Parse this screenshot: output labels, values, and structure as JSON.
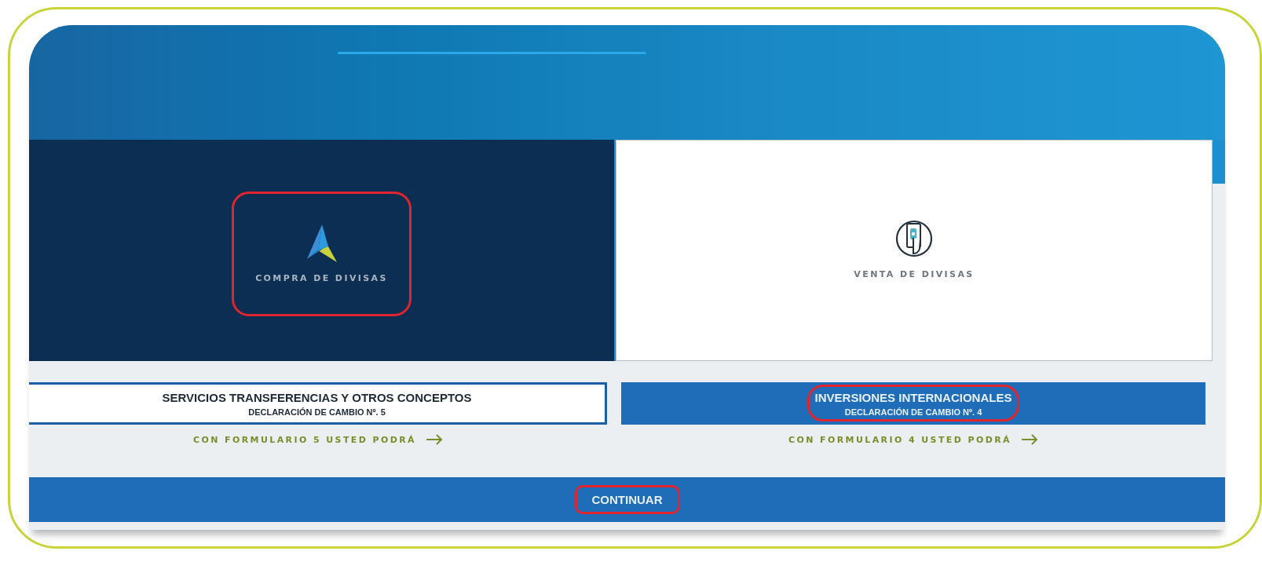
{
  "tiles": [
    {
      "kind": "arrow",
      "label": "COMPRA DE DIVISAS",
      "selected": true,
      "highlighted": true
    },
    {
      "kind": "phone",
      "label": "VENTA DE DIVISAS",
      "selected": false,
      "highlighted": false
    }
  ],
  "forms": [
    {
      "title": "SERVICIOS TRANSFERENCIAS Y OTROS CONCEPTOS",
      "subtitle": "DECLARACIÓN DE CAMBIO Nº. 5",
      "selected": false,
      "highlighted": false,
      "link": "CON FORMULARIO 5 USTED PODRÁ"
    },
    {
      "title": "INVERSIONES INTERNACIONALES",
      "subtitle": "DECLARACIÓN DE CAMBIO Nº. 4",
      "selected": true,
      "highlighted": true,
      "link": "CON FORMULARIO 4 USTED PODRÁ"
    }
  ],
  "continue_button": {
    "label": "CONTINUAR",
    "highlighted": true
  }
}
